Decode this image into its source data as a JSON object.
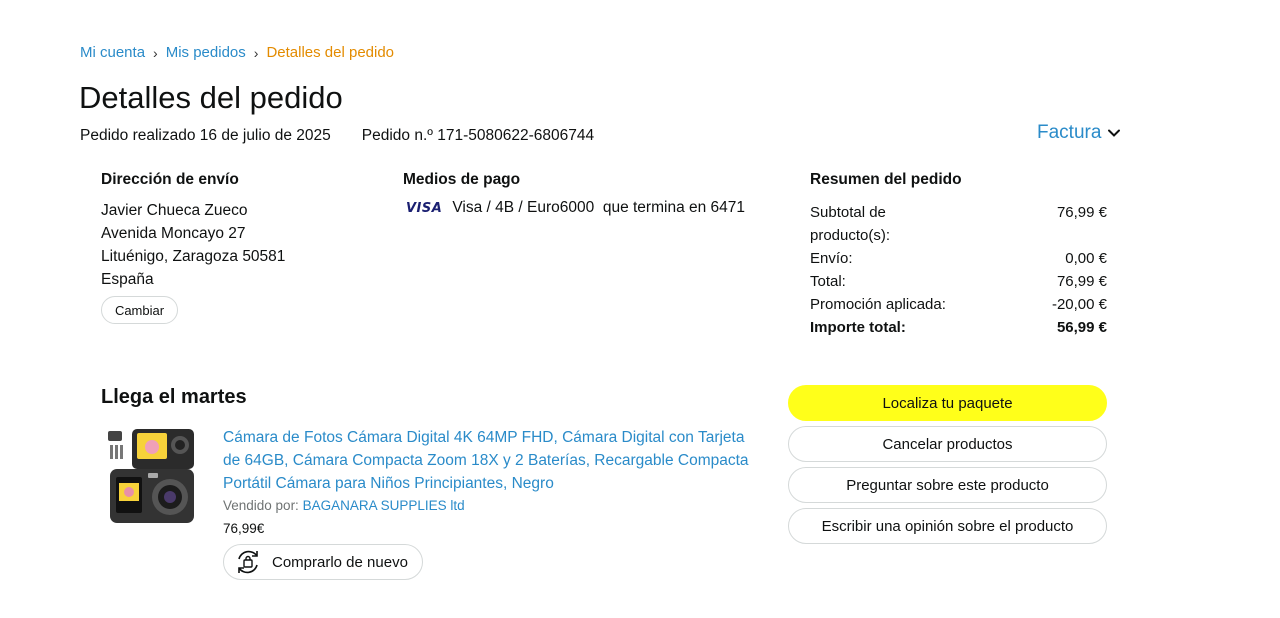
{
  "breadcrumb": {
    "items": [
      "Mi cuenta",
      "Mis pedidos"
    ],
    "separator": "›",
    "current": "Detalles del pedido"
  },
  "page": {
    "title": "Detalles del pedido",
    "order_date": "Pedido realizado 16 de julio de 2025",
    "order_number": "Pedido n.º 171-5080622-6806744",
    "invoice_label": "Factura"
  },
  "shipping": {
    "heading": "Dirección de envío",
    "lines": [
      "Javier Chueca Zueco",
      "Avenida Moncayo 27",
      "Lituénigo, Zaragoza 50581",
      "España"
    ],
    "change_label": "Cambiar"
  },
  "payment": {
    "heading": "Medios de pago",
    "card_brand": "VISA",
    "description": "Visa / 4B / Euro6000  que termina en 6471"
  },
  "summary": {
    "heading": "Resumen del pedido",
    "rows": [
      {
        "label": "Subtotal de producto(s):",
        "value": "76,99 €"
      },
      {
        "label": "Envío:",
        "value": "0,00 €"
      },
      {
        "label": "Total:",
        "value": "76,99 €"
      },
      {
        "label": "Promoción aplicada:",
        "value": "-20,00 €"
      }
    ],
    "total": {
      "label": "Importe total:",
      "value": "56,99 €"
    }
  },
  "delivery": {
    "heading": "Llega el martes",
    "product": {
      "title": "Cámara de Fotos Cámara Digital 4K 64MP FHD, Cámara Digital con Tarjeta de 64GB, Cámara Compacta Zoom 18X y 2 Baterías, Recargable Compacta Portátil Cámara para Niños Principiantes, Negro",
      "seller_prefix": "Vendido por: ",
      "seller_name": "BAGANARA SUPPLIES ltd",
      "price": "76,99€",
      "buy_again_label": "Comprarlo de nuevo",
      "image_icon": "camera-product-image"
    }
  },
  "actions": {
    "track": "Localiza tu paquete",
    "cancel": "Cancelar productos",
    "ask": "Preguntar sobre este producto",
    "review": "Escribir una opinión sobre el producto"
  },
  "colors": {
    "link": "#2a8bc9",
    "breadcrumb_current": "#e38b00",
    "primary_button": "#ffff1a",
    "border": "#d5d9d9"
  }
}
